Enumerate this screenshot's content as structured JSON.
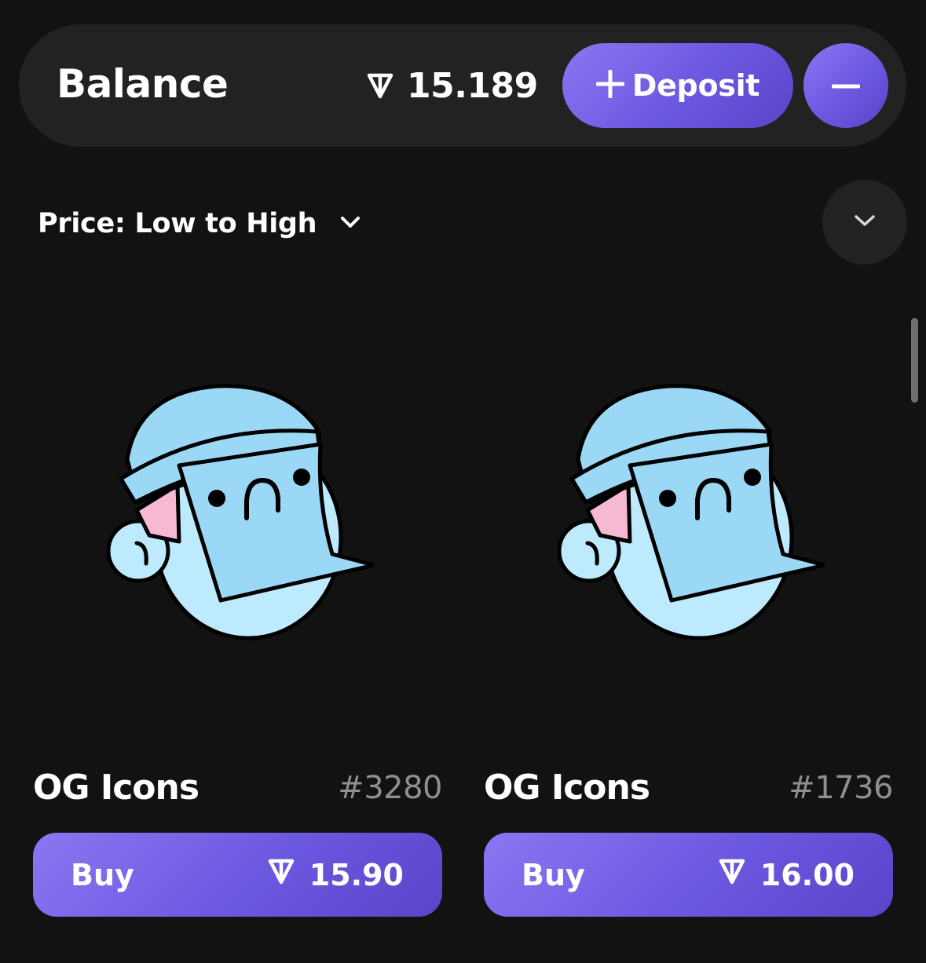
{
  "balance": {
    "label": "Balance",
    "amount": "15.189",
    "currency_icon": "ton-icon",
    "deposit_label": "Deposit",
    "deposit_icon": "plus-icon",
    "withdraw_icon": "minus-icon"
  },
  "sort": {
    "label": "Price: Low to High",
    "icon": "chevron-down-icon"
  },
  "filter_toggle": {
    "icon": "chevron-down-icon"
  },
  "items": [
    {
      "name": "OG Icons",
      "number": "#3280",
      "buy_label": "Buy",
      "price": "15.90",
      "image": "og-icon-character"
    },
    {
      "name": "OG Icons",
      "number": "#1736",
      "buy_label": "Buy",
      "price": "16.00",
      "image": "og-icon-character"
    }
  ],
  "colors": {
    "background": "#121212",
    "surface": "#222222",
    "accent": "#7A66EA",
    "muted_text": "#8E8E93",
    "art_blue": "#9AD8F6",
    "art_pink": "#F7B8D4"
  }
}
